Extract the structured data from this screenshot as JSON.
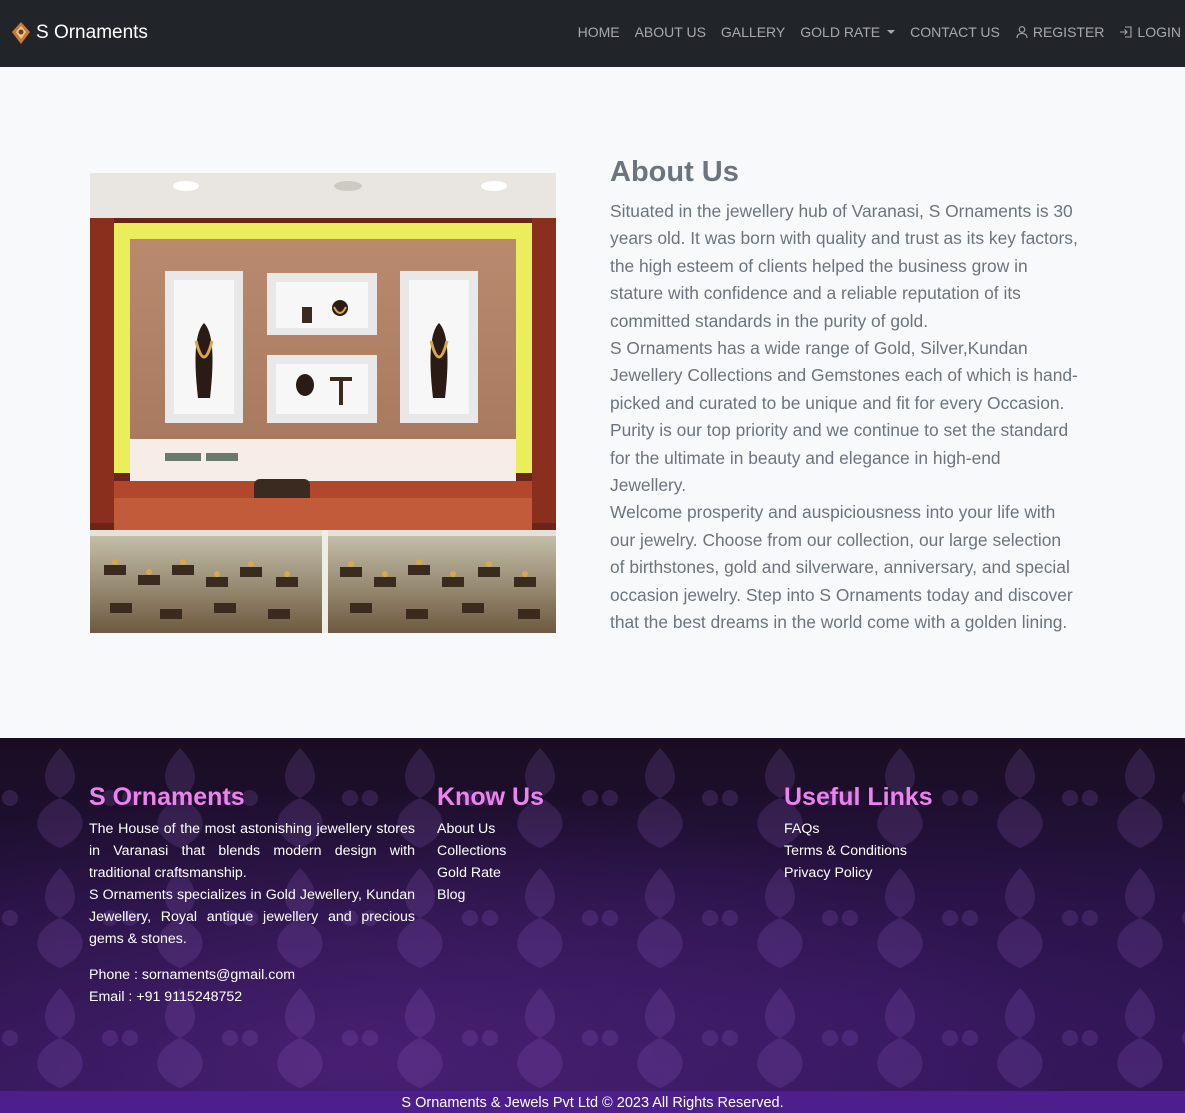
{
  "navbar": {
    "brand": "S Ornaments",
    "items": [
      {
        "label": "HOME"
      },
      {
        "label": "ABOUT US"
      },
      {
        "label": "GALLERY"
      },
      {
        "label": "GOLD RATE"
      },
      {
        "label": "CONTACT US"
      },
      {
        "label": "REGISTER",
        "icon": "user-icon"
      },
      {
        "label": "LOGIN",
        "icon": "login-icon"
      }
    ]
  },
  "about": {
    "title": "About Us",
    "paragraphs": [
      "Situated in the jewellery hub of Varanasi, S Ornaments is 30 years old. It was born with quality and trust as its key factors, the high esteem of clients helped the business grow in stature with confidence and a reliable reputation of its committed standards in the purity of gold.",
      "S Ornaments has a wide range of Gold, Silver,Kundan Jewellery Collections and Gemstones each of which is hand-picked and curated to be unique and fit for every Occasion. Purity is our top priority and we continue to set the standard for the ultimate in beauty and elegance in high-end Jewellery.",
      "Welcome prosperity and auspiciousness into your life with our jewelry. Choose from our collection, our large selection of birthstones, gold and silverware, anniversary, and special occasion jewelry. Step into S Ornaments today and discover that the best dreams in the world come with a golden lining."
    ]
  },
  "footer": {
    "col1": {
      "title": "S Ornaments",
      "desc1": "The House of the most astonishing jewellery stores in Varanasi that blends modern design with traditional craftsmanship.",
      "desc2": "S Ornaments specializes in Gold Jewellery, Kundan Jewellery, Royal antique jewellery and precious gems & stones.",
      "phone": "Phone : sornaments@gmail.com",
      "email": "Email : +91 9115248752"
    },
    "col2": {
      "title": "Know Us",
      "links": [
        "About Us",
        "Collections",
        "Gold Rate",
        "Blog"
      ]
    },
    "col3": {
      "title": "Useful Links",
      "links": [
        "FAQs",
        "Terms & Conditions",
        "Privacy Policy"
      ]
    },
    "copyright": "S Ornaments & Jewels Pvt Ltd © 2023 All Rights Reserved."
  },
  "colors": {
    "navbar_bg": "#212529",
    "footer_heading": "#ee82ee",
    "copyright_bg": "#4d1f8c",
    "text_muted": "#6c757d"
  }
}
